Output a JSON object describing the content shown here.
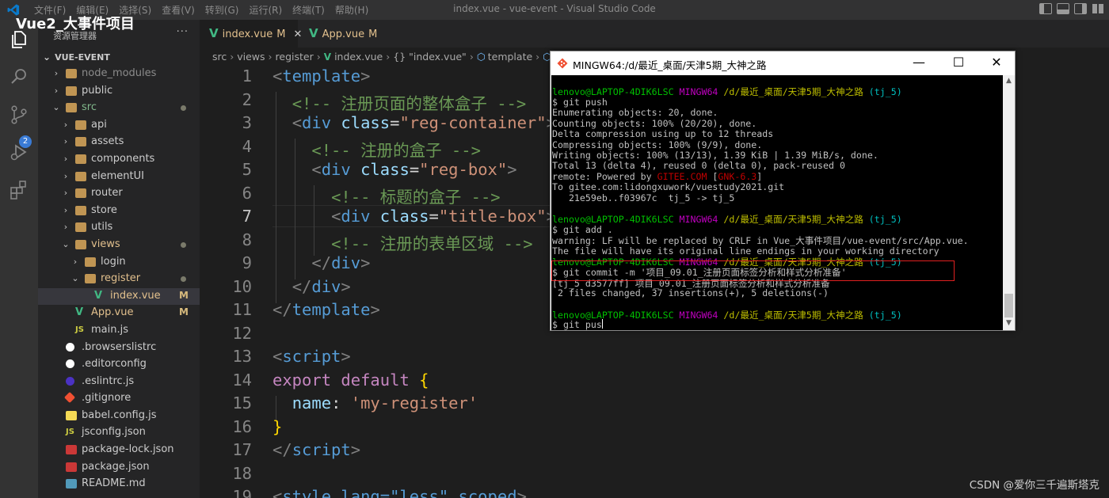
{
  "overlay_title": "Vue2_大事件项目",
  "window_title": "index.vue - vue-event - Visual Studio Code",
  "menu": [
    "文件(F)",
    "编辑(E)",
    "选择(S)",
    "查看(V)",
    "转到(G)",
    "运行(R)",
    "终端(T)",
    "帮助(H)"
  ],
  "activity": {
    "scm_badge": "2"
  },
  "sidebar": {
    "title": "资源管理器",
    "more": "···",
    "project": "VUE-EVENT",
    "items": [
      {
        "label": "node_modules",
        "kind": "folder",
        "depth": 1,
        "state": "dim",
        "status": ""
      },
      {
        "label": "public",
        "kind": "folder",
        "depth": 1,
        "state": "",
        "status": ""
      },
      {
        "label": "src",
        "kind": "folder-open",
        "depth": 1,
        "state": "green",
        "status": "dot"
      },
      {
        "label": "api",
        "kind": "folder",
        "depth": 2,
        "state": "",
        "status": ""
      },
      {
        "label": "assets",
        "kind": "folder",
        "depth": 2,
        "state": "",
        "status": ""
      },
      {
        "label": "components",
        "kind": "folder",
        "depth": 2,
        "state": "",
        "status": ""
      },
      {
        "label": "elementUI",
        "kind": "folder",
        "depth": 2,
        "state": "",
        "status": ""
      },
      {
        "label": "router",
        "kind": "folder",
        "depth": 2,
        "state": "",
        "status": ""
      },
      {
        "label": "store",
        "kind": "folder",
        "depth": 2,
        "state": "",
        "status": ""
      },
      {
        "label": "utils",
        "kind": "folder",
        "depth": 2,
        "state": "",
        "status": ""
      },
      {
        "label": "views",
        "kind": "folder-open",
        "depth": 2,
        "state": "mod",
        "status": "dot"
      },
      {
        "label": "login",
        "kind": "folder",
        "depth": 3,
        "state": "",
        "status": ""
      },
      {
        "label": "register",
        "kind": "folder-open",
        "depth": 3,
        "state": "mod",
        "status": "dot"
      },
      {
        "label": "index.vue",
        "kind": "vue",
        "depth": 4,
        "state": "mod",
        "status": "M"
      },
      {
        "label": "App.vue",
        "kind": "vue",
        "depth": 2,
        "state": "mod",
        "status": "M"
      },
      {
        "label": "main.js",
        "kind": "js",
        "depth": 2,
        "state": "",
        "status": ""
      },
      {
        "label": ".browserslistrc",
        "kind": "dotfile",
        "depth": 1,
        "state": "",
        "status": ""
      },
      {
        "label": ".editorconfig",
        "kind": "gear",
        "depth": 1,
        "state": "",
        "status": ""
      },
      {
        "label": ".eslintrc.js",
        "kind": "eslint",
        "depth": 1,
        "state": "",
        "status": ""
      },
      {
        "label": ".gitignore",
        "kind": "git",
        "depth": 1,
        "state": "",
        "status": ""
      },
      {
        "label": "babel.config.js",
        "kind": "babel",
        "depth": 1,
        "state": "",
        "status": ""
      },
      {
        "label": "jsconfig.json",
        "kind": "js",
        "depth": 1,
        "state": "",
        "status": ""
      },
      {
        "label": "package-lock.json",
        "kind": "npm",
        "depth": 1,
        "state": "",
        "status": ""
      },
      {
        "label": "package.json",
        "kind": "npm",
        "depth": 1,
        "state": "",
        "status": ""
      },
      {
        "label": "README.md",
        "kind": "readme",
        "depth": 1,
        "state": "",
        "status": ""
      }
    ]
  },
  "tabs": [
    {
      "label": "index.vue",
      "status": "M",
      "close": "✕"
    },
    {
      "label": "App.vue",
      "status": "M"
    }
  ],
  "breadcrumb": [
    "src",
    "views",
    "register",
    "index.vue",
    "{} \"index.vue\"",
    "template"
  ],
  "code_lines": [
    {
      "n": "1"
    },
    {
      "n": "2"
    },
    {
      "n": "3"
    },
    {
      "n": "4"
    },
    {
      "n": "5"
    },
    {
      "n": "6"
    },
    {
      "n": "7"
    },
    {
      "n": "8"
    },
    {
      "n": "9"
    },
    {
      "n": "10"
    },
    {
      "n": "11"
    },
    {
      "n": "12"
    },
    {
      "n": "13"
    },
    {
      "n": "14"
    },
    {
      "n": "15"
    },
    {
      "n": "16"
    },
    {
      "n": "17"
    },
    {
      "n": "18"
    },
    {
      "n": "19"
    }
  ],
  "code": {
    "l1_tag": "template",
    "l2_comment": "<!-- 注册页面的整体盒子 -->",
    "l3_tag": "div",
    "l3_attr": "class",
    "l3_val": "\"reg-container\"",
    "l4_comment": "<!-- 注册的盒子 -->",
    "l5_tag": "div",
    "l5_attr": "class",
    "l5_val": "\"reg-box\"",
    "l6_comment": "<!-- 标题的盒子 -->",
    "l7_tag": "div",
    "l7_attr": "class",
    "l7_val": "\"title-box\"",
    "l8_comment": "<!-- 注册的表单区域 -->",
    "l9_tag": "div",
    "l10_tag": "div",
    "l11_tag": "template",
    "l13_tag": "script",
    "l14_kw": "export default",
    "l15_key": "name",
    "l15_val": "'my-register'",
    "l17_tag": "script",
    "l19_text": "style lang=\"less\" scoped"
  },
  "terminal": {
    "title": "MINGW64:/d/最近_桌面/天津5期_大神之路",
    "buttons": {
      "min": "—",
      "max": "☐",
      "close": "✕"
    },
    "prompt_user": "lenovo@LAPTOP-4DIK6LSC",
    "prompt_sys": "MINGW64",
    "prompt_path": "/d/最近_桌面/天津5期_大神之路",
    "prompt_branch": "(tj_5)",
    "lines": {
      "c1": "$ git push",
      "o1": "Enumerating objects: 20, done.",
      "o2": "Counting objects: 100% (20/20), done.",
      "o3": "Delta compression using up to 12 threads",
      "o4": "Compressing objects: 100% (9/9), done.",
      "o5": "Writing objects: 100% (13/13), 1.39 KiB | 1.39 MiB/s, done.",
      "o6": "Total 13 (delta 4), reused 0 (delta 0), pack-reused 0",
      "o7a": "remote: Powered by ",
      "o7b": "GITEE.COM",
      "o7c": " [",
      "o7d": "GNK-6.3",
      "o7e": "]",
      "o8": "To gitee.com:lidongxuwork/vuestudy2021.git",
      "o9": "   21e59eb..f03967c  tj_5 -> tj_5",
      "c2": "$ git add .",
      "w1": "warning: LF will be replaced by CRLF in Vue_大事件项目/vue-event/src/App.vue.",
      "w2": "The file will have its original line endings in your working directory",
      "c3": "$ git commit -m '项目_09.01_注册页面标签分析和样式分析准备'",
      "r1": "[tj_5 d3577ff] 项目_09.01_注册页面标签分析和样式分析准备",
      "r2": " 2 files changed, 37 insertions(+), 5 deletions(-)",
      "c4": "$ git pus"
    }
  },
  "watermark": "CSDN @爱你三千遍斯塔克",
  "colors": {
    "vscode_bg": "#1e1e1e",
    "sidebar_bg": "#252526",
    "activity_bg": "#333333",
    "vue_green": "#41b883",
    "modified": "#e2c08d",
    "highlight_box": "#e02020"
  }
}
